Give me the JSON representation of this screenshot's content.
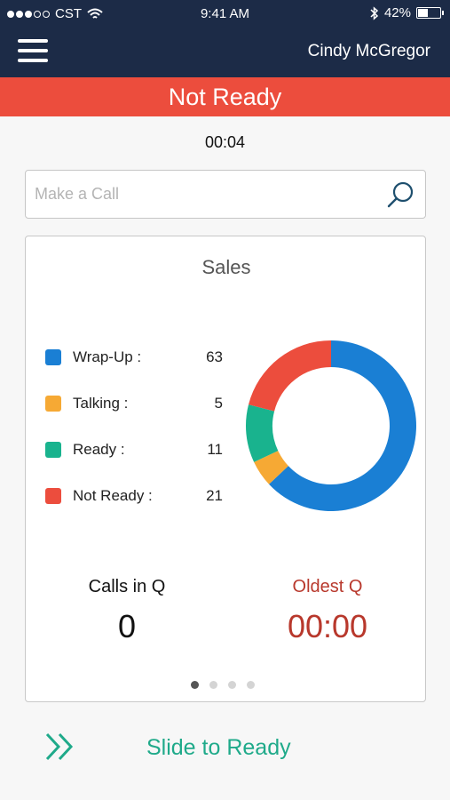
{
  "status_bar": {
    "carrier": "CST",
    "time": "9:41 AM",
    "battery": "42%",
    "battery_level": 0.42
  },
  "header": {
    "menu_icon": "hamburger-menu-icon",
    "user_name": "Cindy McGregor"
  },
  "banner": {
    "status": "Not Ready",
    "color": "#ec4d3d"
  },
  "timer": "00:04",
  "search": {
    "placeholder": "Make a Call",
    "value": "",
    "icon": "search-icon"
  },
  "card": {
    "title": "Sales",
    "legend": [
      {
        "label": "Wrap-Up :",
        "value": "63",
        "color": "#1a7fd4"
      },
      {
        "label": "Talking :",
        "value": "5",
        "color": "#f6a934"
      },
      {
        "label": "Ready :",
        "value": "11",
        "color": "#19b38e"
      },
      {
        "label": "Not Ready :",
        "value": "21",
        "color": "#ec4d3d"
      }
    ],
    "calls_in_q_label": "Calls in Q",
    "calls_in_q_value": "0",
    "oldest_q_label": "Oldest Q",
    "oldest_q_value": "00:00",
    "pager": {
      "count": 4,
      "active": 0
    }
  },
  "chart_data": {
    "type": "pie",
    "title": "Sales",
    "categories": [
      "Wrap-Up",
      "Talking",
      "Ready",
      "Not Ready"
    ],
    "values": [
      63,
      5,
      11,
      21
    ],
    "colors": [
      "#1a7fd4",
      "#f6a934",
      "#19b38e",
      "#ec4d3d"
    ],
    "donut": true
  },
  "slide": {
    "label": "Slide to Ready",
    "icon": "double-chevron-right-icon",
    "color": "#1faa8a"
  }
}
